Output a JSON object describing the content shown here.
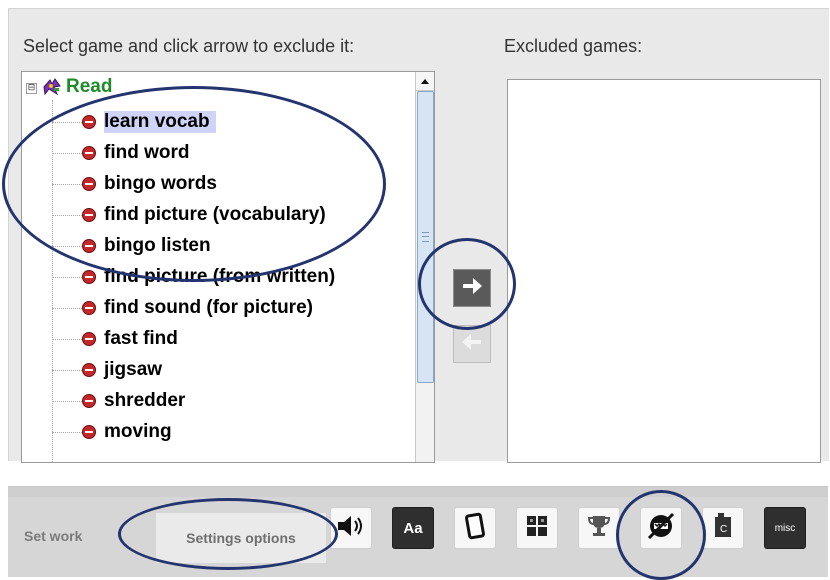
{
  "game_selector": {
    "instruction": "Select game and click arrow to exclude it:",
    "excluded_label": "Excluded games:",
    "tree": {
      "root": {
        "label": "Read",
        "expander": "⊟"
      },
      "items": [
        {
          "label": "learn vocab",
          "selected": true
        },
        {
          "label": "find word"
        },
        {
          "label": "bingo words"
        },
        {
          "label": "find picture (vocabulary)"
        },
        {
          "label": "bingo listen"
        },
        {
          "label": "find picture (from written)"
        },
        {
          "label": "find sound (for picture)"
        },
        {
          "label": "fast find"
        },
        {
          "label": "jigsaw"
        },
        {
          "label": "shredder"
        },
        {
          "label": "moving"
        }
      ]
    },
    "buttons": {
      "exclude_arrow_icon": "arrow-right-icon",
      "include_arrow_icon": "arrow-left-icon",
      "include_disabled": true
    }
  },
  "toolbar": {
    "tabs": {
      "set_work": "Set work",
      "settings_options": "Settings options"
    },
    "tools": [
      {
        "icon": "speaker-icon"
      },
      {
        "icon": "font-icon",
        "text": "Aa"
      },
      {
        "icon": "card-icon"
      },
      {
        "icon": "grid-icon"
      },
      {
        "icon": "trophy-icon"
      },
      {
        "icon": "game-exclude-icon"
      },
      {
        "icon": "c-note-icon"
      },
      {
        "icon": "misc-icon",
        "text": "misc"
      }
    ]
  },
  "colors": {
    "root_label": "#1e8a2a",
    "selection": "#cfd3f5",
    "highlight_ellipse": "#24346e",
    "game_icon": "#c4282a"
  }
}
